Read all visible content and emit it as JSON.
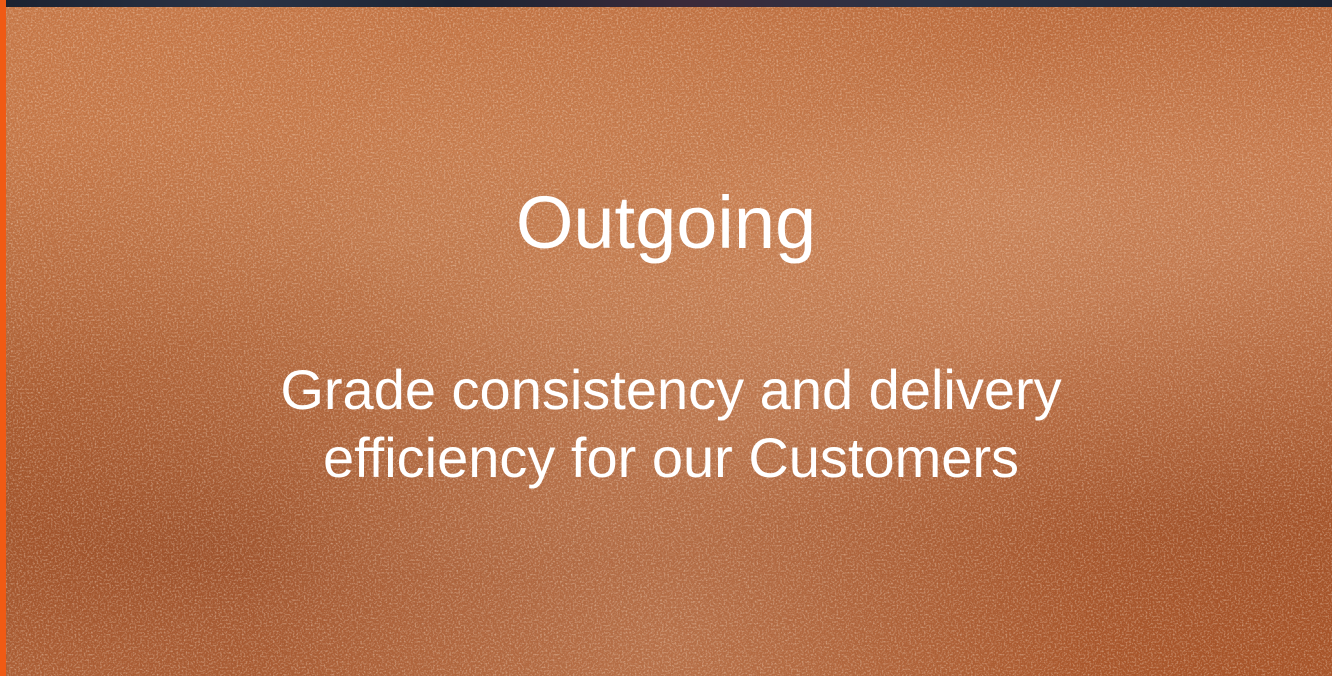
{
  "slide": {
    "title": "Outgoing",
    "subtitle_lines": [
      "Grade consistency and delivery",
      "efficiency for our Customers"
    ]
  },
  "colors": {
    "accent_stripe": "#f05a14",
    "background_copper": "#b45a2a",
    "text": "#ffffff"
  }
}
